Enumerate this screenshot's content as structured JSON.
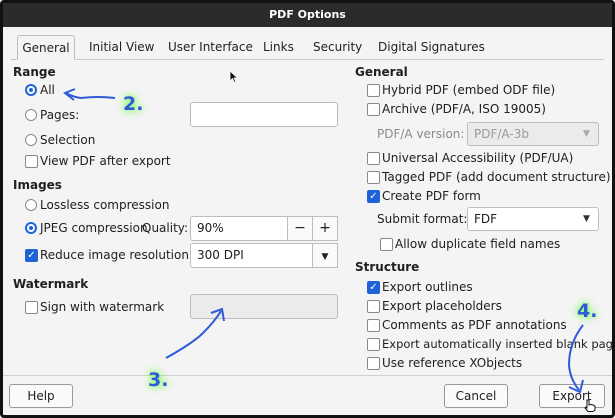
{
  "window": {
    "title": "PDF Options"
  },
  "tabs": [
    "General",
    "Initial View",
    "User Interface",
    "Links",
    "Security",
    "Digital Signatures"
  ],
  "range": {
    "title": "Range",
    "all": "All",
    "pages": "Pages:",
    "selection": "Selection",
    "view_after": "View PDF after export"
  },
  "images": {
    "title": "Images",
    "lossless": "Lossless compression",
    "jpeg": "JPEG compression",
    "quality_label": "Quality:",
    "quality_value": "90%",
    "minus": "−",
    "plus": "+",
    "reduce": "Reduce image resolution to:",
    "dpi_value": "300 DPI"
  },
  "watermark": {
    "title": "Watermark",
    "sign": "Sign with watermark"
  },
  "general": {
    "title": "General",
    "hybrid": "Hybrid PDF (embed ODF file)",
    "archive": "Archive (PDF/A, ISO 19005)",
    "pdfa_label": "PDF/A version:",
    "pdfa_value": "PDF/A-3b",
    "universal": "Universal Accessibility (PDF/UA)",
    "tagged": "Tagged PDF (add document structure)",
    "create_form": "Create PDF form",
    "submit_label": "Submit format:",
    "submit_value": "FDF",
    "allow_dup": "Allow duplicate field names"
  },
  "structure": {
    "title": "Structure",
    "outlines": "Export outlines",
    "placeholders": "Export placeholders",
    "comments": "Comments as PDF annotations",
    "blank_pages": "Export automatically inserted blank pages",
    "xobjects": "Use reference XObjects"
  },
  "buttons": {
    "help": "Help",
    "cancel": "Cancel",
    "export": "Export"
  },
  "annotations": {
    "a2": "2.",
    "a3": "3.",
    "a4": "4."
  },
  "colors": {
    "accent": "#1e63d6",
    "annotation": "#2f5bd8",
    "glow": "#7cff5a"
  }
}
